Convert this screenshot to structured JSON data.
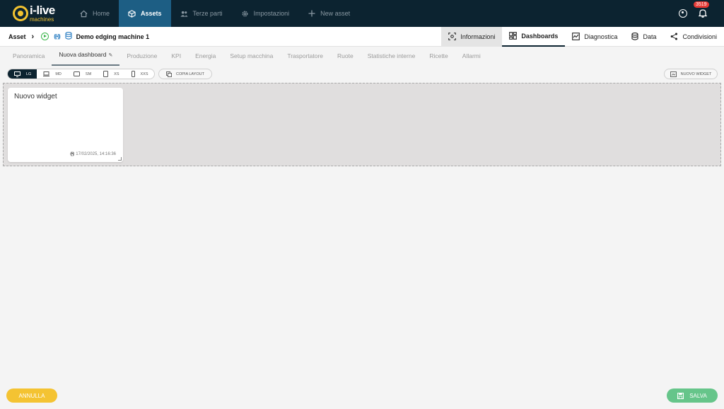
{
  "brand": {
    "name": "i-live",
    "sub": "machines"
  },
  "nav": [
    {
      "label": "Home",
      "icon": "home-icon"
    },
    {
      "label": "Assets",
      "icon": "cube-icon",
      "active": true
    },
    {
      "label": "Terze parti",
      "icon": "users-icon"
    },
    {
      "label": "Impostazioni",
      "icon": "gear-icon"
    },
    {
      "label": "New asset",
      "icon": "plus-icon"
    }
  ],
  "notifications": {
    "count": "3519"
  },
  "breadcrumb": {
    "root": "Asset",
    "asset": "Demo edging machine 1"
  },
  "right_tabs": [
    {
      "label": "Informazioni",
      "icon": "scan-icon"
    },
    {
      "label": "Dashboards",
      "icon": "dashboard-icon",
      "active": true
    },
    {
      "label": "Diagnostica",
      "icon": "chart-icon"
    },
    {
      "label": "Data",
      "icon": "database-icon"
    },
    {
      "label": "Condivisioni",
      "icon": "share-icon"
    }
  ],
  "dashboard_tabs": [
    "Panoramica",
    "Nuova dashboard",
    "Produzione",
    "KPI",
    "Energia",
    "Setup macchina",
    "Trasportatore",
    "Ruote",
    "Statistiche interne",
    "Ricette",
    "Allarmi"
  ],
  "active_dashboard_tab": "Nuova dashboard",
  "sizes": [
    "LG",
    "MD",
    "SM",
    "XS",
    "XXS"
  ],
  "active_size": "LG",
  "copy_layout": "COPIA LAYOUT",
  "new_widget_button": "NUOVO WIDGET",
  "widget": {
    "title": "Nuovo widget",
    "timestamp": "17/02/2025, 14:16:36"
  },
  "buttons": {
    "cancel": "ANNULLA",
    "save": "SALVA"
  },
  "colors": {
    "topbar": "#0c2330",
    "active_nav": "#1d5e84",
    "accent_yellow": "#f4c332",
    "save_green": "#66c58a",
    "badge_red": "#e53935"
  }
}
